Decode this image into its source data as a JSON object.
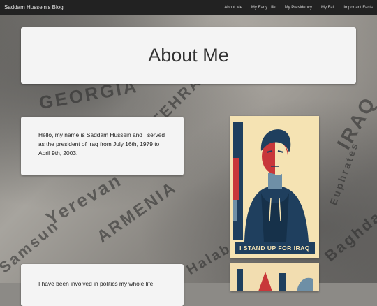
{
  "navbar": {
    "brand": "Saddam Hussein's Blog",
    "links": [
      "About Me",
      "My Early Life",
      "My Presidency",
      "My Fall",
      "Important Facts"
    ]
  },
  "main": {
    "title": "About Me",
    "intro": "Hello, my name is Saddam Hussein and I served as the president of Iraq from July 16th, 1979 to April 9th, 2003.",
    "second_paragraph": "I have been involved in politics my whole life"
  },
  "poster": {
    "caption": "I STAND UP FOR IRAQ",
    "colors": {
      "cream": "#f5e3b3",
      "navy": "#1f3f5e",
      "red": "#c8373a",
      "blue": "#6e8fa6"
    }
  },
  "background_words": [
    "GEORGIA",
    "ARMENIA",
    "Yerevan",
    "Samsun",
    "Baghdad",
    "IRAQ",
    "Halab",
    "TEHRAN",
    "Euphrates"
  ]
}
